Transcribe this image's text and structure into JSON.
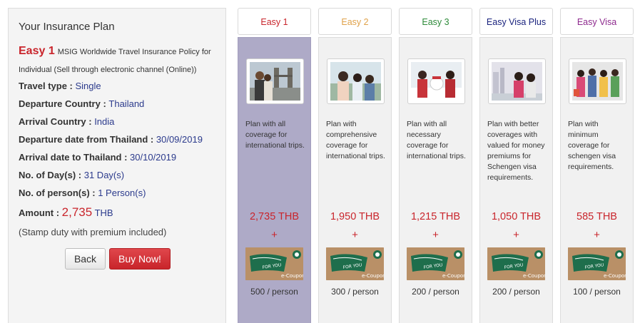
{
  "summary": {
    "title": "Your Insurance Plan",
    "plan_name": "Easy 1",
    "plan_desc": "MSIG Worldwide Travel Insurance Policy for Individual (Sell through electronic channel (Online))",
    "rows": [
      {
        "label": "Travel type : ",
        "value": "Single"
      },
      {
        "label": "Departure Country : ",
        "value": "Thailand"
      },
      {
        "label": "Arrival Country : ",
        "value": "India"
      },
      {
        "label": "Departure date from Thailand : ",
        "value": "30/09/2019"
      },
      {
        "label": "Arrival date to Thailand : ",
        "value": "30/10/2019"
      },
      {
        "label": "No. of Day(s) : ",
        "value": "31 Day(s)"
      },
      {
        "label": "No. of person(s) : ",
        "value": "1 Person(s)"
      }
    ],
    "amount_label": "Amount : ",
    "amount_value": "2,735",
    "amount_currency": "THB",
    "stamp_note": "(Stamp duty with premium included)",
    "back_label": "Back",
    "buy_label": "Buy Now!"
  },
  "plans": [
    {
      "name": "Easy 1",
      "color": "#c9252c",
      "selected": true,
      "desc": "Plan with all coverage for international trips.",
      "price": "2,735 THB",
      "plus": "+",
      "coupon": "500 / person"
    },
    {
      "name": "Easy 2",
      "color": "#e0a24a",
      "selected": false,
      "desc": "Plan with comprehensive coverage for international trips.",
      "price": "1,950 THB",
      "plus": "+",
      "coupon": "300 / person"
    },
    {
      "name": "Easy 3",
      "color": "#2e8b3a",
      "selected": false,
      "desc": "Plan with all necessary coverage for international trips.",
      "price": "1,215 THB",
      "plus": "+",
      "coupon": "200 / person"
    },
    {
      "name": "Easy Visa Plus",
      "color": "#1a237e",
      "selected": false,
      "desc": "Plan with better coverages with valued for money premiums for Schengen visa requirements.",
      "price": "1,050 THB",
      "plus": "+",
      "coupon": "200 / person"
    },
    {
      "name": "Easy Visa",
      "color": "#8e2a8e",
      "selected": false,
      "desc": "Plan with minimum coverage for schengen visa requirements.",
      "price": "585 THB",
      "plus": "+",
      "coupon": "100 / person"
    }
  ],
  "coupon_image": {
    "script_text": "FOR YOU",
    "label": "e-Coupon"
  }
}
